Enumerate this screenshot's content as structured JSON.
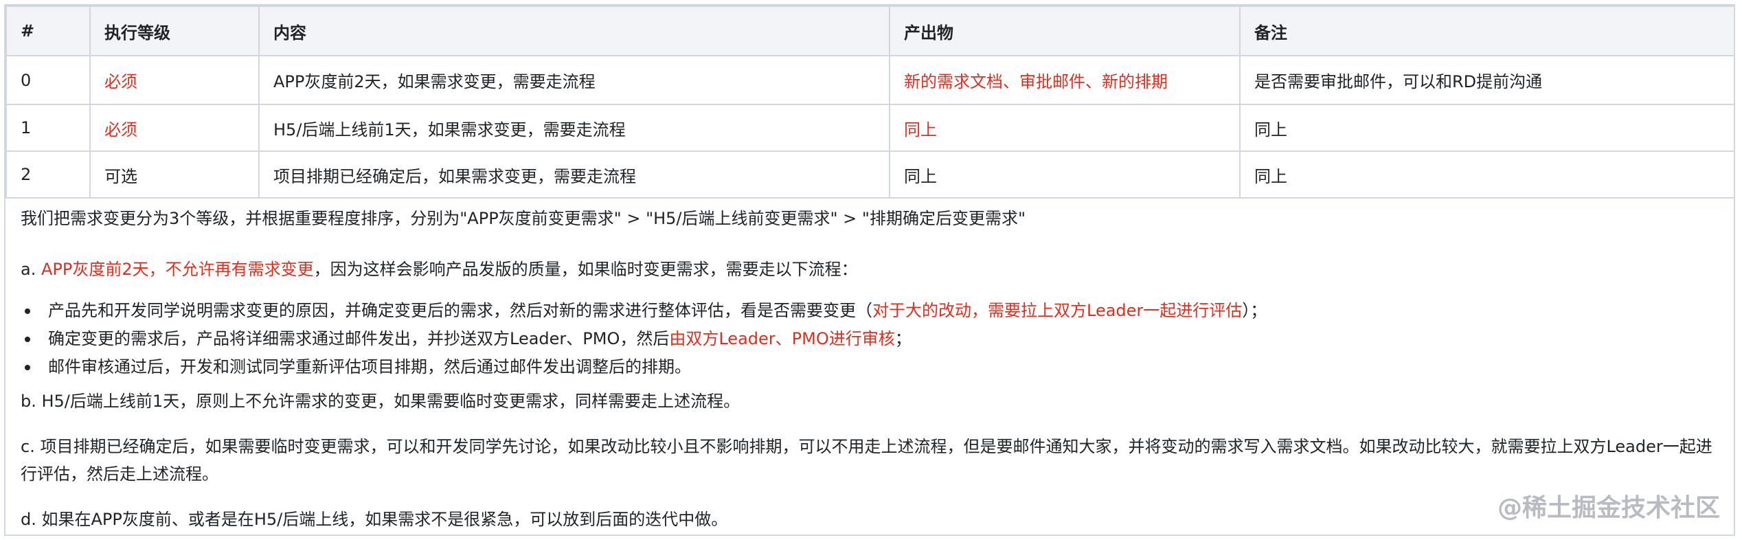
{
  "table": {
    "headers": [
      "#",
      "执行等级",
      "内容",
      "产出物",
      "备注"
    ],
    "rows": [
      {
        "num": "0",
        "level": "必须",
        "content": "APP灰度前2天，如果需求变更，需要走流程",
        "output": "新的需求文档、审批邮件、新的排期",
        "note": "是否需要审批邮件，可以和RD提前沟通"
      },
      {
        "num": "1",
        "level": "必须",
        "content": "H5/后端上线前1天，如果需求变更，需要走流程",
        "output": "同上",
        "note": "同上"
      },
      {
        "num": "2",
        "level": "可选",
        "content": "项目排期已经确定后，如果需求变更，需要走流程",
        "output": "同上",
        "note": "同上"
      }
    ]
  },
  "notes": {
    "intro": "我们把需求变更分为3个等级，并根据重要程度排序，分别为\"APP灰度前变更需求\" > \"H5/后端上线前变更需求\" > \"排期确定后变更需求\"",
    "a_prefix": "a. ",
    "a_red": "APP灰度前2天，不允许再有需求变更",
    "a_rest": "，因为这样会影响产品发版的质量，如果临时变更需求，需要走以下流程：",
    "bullets": [
      {
        "text": "产品先和开发同学说明需求变更的原因，并确定变更后的需求，然后对新的需求进行整体评估，看是否需要变更（",
        "red": "对于大的改动，需要拉上双方Leader一起进行评估",
        "tail": "）；"
      },
      {
        "text": "确定变更的需求后，产品将详细需求通过邮件发出，并抄送双方Leader、PMO，然后",
        "red": "由双方Leader、PMO进行审核",
        "tail": "；"
      },
      {
        "text": "邮件审核通过后，开发和测试同学重新评估项目排期，然后通过邮件发出调整后的排期。",
        "red": "",
        "tail": ""
      }
    ],
    "b": "b. H5/后端上线前1天，原则上不允许需求的变更，如果需要临时变更需求，同样需要走上述流程。",
    "c": "c. 项目排期已经确定后，如果需要临时变更需求，可以和开发同学先讨论，如果改动比较小且不影响排期，可以不用走上述流程，但是要邮件通知大家，并将变动的需求写入需求文档。如果改动比较大，就需要拉上双方Leader一起进行评估，然后走上述流程。",
    "d": "d. 如果在APP灰度前、或者是在H5/后端上线，如果需求不是很紧急，可以放到后面的迭代中做。"
  },
  "watermark": "@稀土掘金技术社区",
  "colors": {
    "emphasis": "#d9301f",
    "header_bg": "#f2f4f7",
    "border": "#d0d7de"
  }
}
